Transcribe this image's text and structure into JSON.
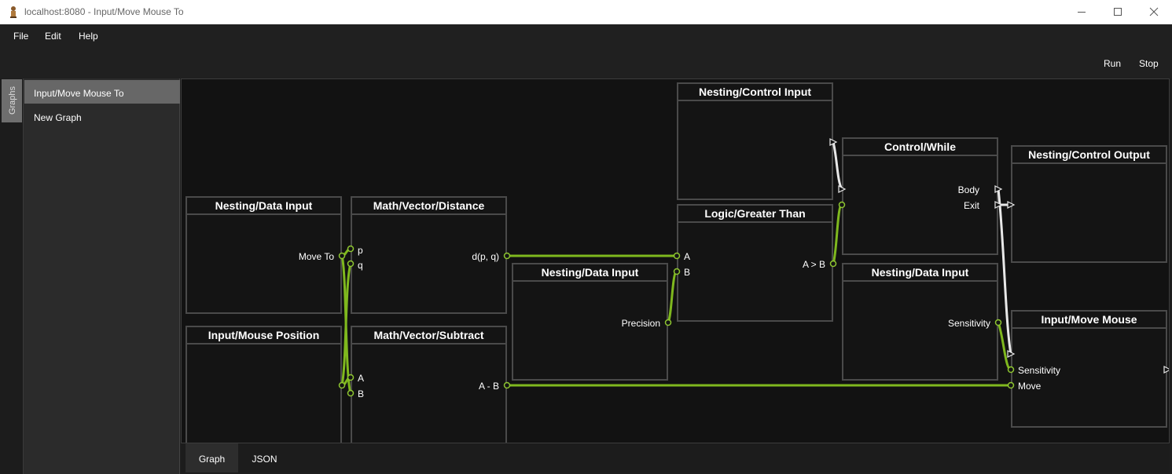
{
  "window": {
    "title": "localhost:8080 - Input/Move Mouse To"
  },
  "menu": {
    "items": [
      {
        "label": "File"
      },
      {
        "label": "Edit"
      },
      {
        "label": "Help"
      }
    ]
  },
  "toolbar": {
    "run_label": "Run",
    "stop_label": "Stop"
  },
  "side_tab": {
    "label": "Graphs"
  },
  "graphs": {
    "items": [
      {
        "label": "Input/Move Mouse To",
        "selected": true
      },
      {
        "label": "New Graph",
        "selected": false
      }
    ]
  },
  "nodes": {
    "data_input_1": {
      "title": "Nesting/Data Input",
      "out": "Move To"
    },
    "mouse_position": {
      "title": "Input/Mouse Position"
    },
    "distance": {
      "title": "Math/Vector/Distance",
      "in_p": "p",
      "in_q": "q",
      "out": "d(p, q)"
    },
    "subtract": {
      "title": "Math/Vector/Subtract",
      "in_a": "A",
      "in_b": "B",
      "out": "A - B"
    },
    "data_input_2": {
      "title": "Nesting/Data Input",
      "out": "Precision"
    },
    "control_input": {
      "title": "Nesting/Control Input"
    },
    "greater_than": {
      "title": "Logic/Greater Than",
      "in_a": "A",
      "in_b": "B",
      "out": "A > B"
    },
    "while": {
      "title": "Control/While",
      "out_body": "Body",
      "out_exit": "Exit"
    },
    "data_input_3": {
      "title": "Nesting/Data Input",
      "out": "Sensitivity"
    },
    "control_output": {
      "title": "Nesting/Control Output"
    },
    "move_mouse": {
      "title": "Input/Move Mouse",
      "in_sensitivity": "Sensitivity",
      "in_move": "Move"
    }
  },
  "colors": {
    "data_wire": "#7fb81e",
    "control_wire": "#e8e8e8",
    "node_border": "#4a4a4a",
    "canvas_bg": "#121212"
  },
  "bottom_tabs": {
    "items": [
      {
        "label": "Graph",
        "selected": true
      },
      {
        "label": "JSON",
        "selected": false
      }
    ]
  }
}
